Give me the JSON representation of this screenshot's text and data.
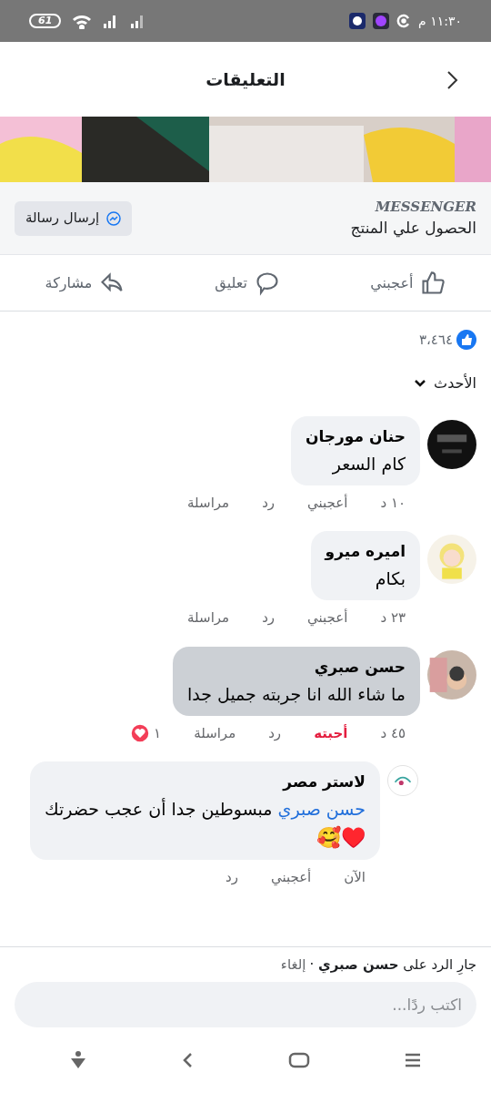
{
  "status_bar": {
    "time": "١١:٣٠ م",
    "battery": "61"
  },
  "header": {
    "title": "التعليقات"
  },
  "post_media": {
    "kind": "picture"
  },
  "messenger_bar": {
    "label": "MESSENGER",
    "headline": "الحصول علي المنتج",
    "button": "إرسال رسالة"
  },
  "actions": [
    "أعجبني",
    "تعليق",
    "مشاركة"
  ],
  "reactions": {
    "count": "٣،٤٦٤"
  },
  "sort": {
    "label": "الأحدث"
  },
  "comments": [
    {
      "kind": "comment",
      "name": "حنان مورجان",
      "text": "كام السعر",
      "time": "١٠ د",
      "like_label": "أعجبني",
      "liked": false,
      "reply": "رد",
      "message": "مراسلة",
      "highlighted": false
    },
    {
      "kind": "comment",
      "name": "اميره ميرو",
      "text": "بكام",
      "time": "٢٣ د",
      "like_label": "أعجبني",
      "liked": false,
      "reply": "رد",
      "message": "مراسلة",
      "highlighted": false
    },
    {
      "kind": "comment",
      "name": "حسن صبري",
      "text": "ما شاء الله انا جربته جميل جدا",
      "time": "٤٥ د",
      "like_label": "أحبته",
      "liked": true,
      "reply": "رد",
      "message": "مراسلة",
      "highlighted": true,
      "reaction_count": "١"
    },
    {
      "kind": "reply",
      "name": "لاستر مصر",
      "mention": "حسن صبري",
      "text": "مبسوطين جدا أن عجب حضرتك",
      "text_line_2": "♥️🥰",
      "time": "الآن",
      "like_label": "أعجبني",
      "liked": false,
      "reply": "رد",
      "highlighted": false
    }
  ],
  "reply_bar": {
    "status": "جارِ الرد على **حسن صبري** ·",
    "cancel": "إلغاء",
    "placeholder": "اكتب ردًا..."
  }
}
